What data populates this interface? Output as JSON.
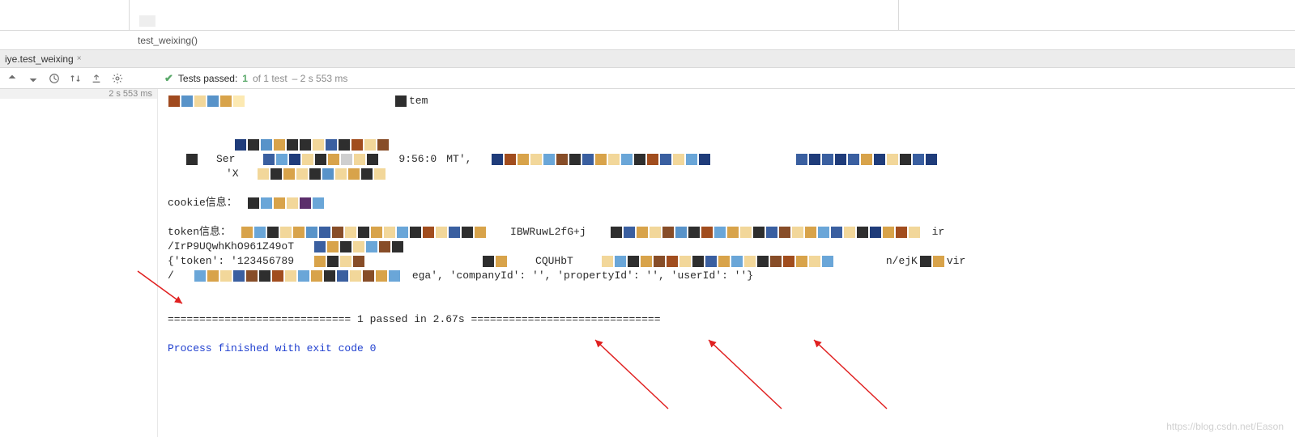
{
  "breadcrumb": "test_weixing()",
  "tab": {
    "label": "iye.test_weixing"
  },
  "toolbar": {
    "tests_label": "Tests passed:",
    "tests_count": "1",
    "tests_rest": "of 1 test",
    "duration": "– 2 s 553 ms"
  },
  "sidebar": {
    "timing": "2 s 553 ms"
  },
  "console": {
    "line_top_partial": "tem",
    "cookie_label": "cookie信息：",
    "token_label": "token信息：",
    "token_mid1": "IBWRuwL2fG+j",
    "token_mid2": "ir",
    "irp_line": "/IrP9UQwhKhO961Z49oT",
    "dict_prefix": "{'token': '123456789",
    "dict_mid1": "CQUHbT",
    "dict_mid2": "n/ejK",
    "dict_mid3": "vir",
    "dict_tail": "ega', 'companyId': '', 'propertyId': '', 'userId': ''}",
    "passed_line": "============================= 1 passed in 2.67s ==============================",
    "exit_line": "Process finished with exit code 0",
    "server_fragment": "Ser",
    "time_fragment": "9:56:0",
    "mt_fragment": "MT',",
    "x_fragment": "'X"
  },
  "cells": {
    "row1": [
      "#a04a1f",
      "#5893c9",
      "#f2d79a",
      "#5893c9",
      "#d8a34a",
      "#fce9b2"
    ],
    "row2": [
      "#1f3c7a",
      "#2e2e2e",
      "#5893c9",
      "#d8a34a",
      "#2e2e2e",
      "#2e2e2e",
      "#f2d79a",
      "#3a5fa0",
      "#2e2e2e",
      "#a14d1e",
      "#f2d79a",
      "#874d28"
    ],
    "row_se1_a": [
      "#2e2e2e"
    ],
    "row_se1_b": [
      "#3a5fa0",
      "#6aa6d8",
      "#1f3c7a",
      "#f2d79a",
      "#2e2e2e",
      "#d8a34a",
      "#cfcfcf",
      "#f2d79a",
      "#2e2e2e"
    ],
    "row_se1_c": [
      "#1f3c7a",
      "#a14d1e",
      "#d8a34a",
      "#f2d79a",
      "#6aa6d8",
      "#874d28",
      "#2e2e2e",
      "#3a5fa0",
      "#d8a34a",
      "#f2d79a",
      "#6aa6d8",
      "#2e2e2e",
      "#a14d1e",
      "#3a5fa0",
      "#f2d79a",
      "#6aa6d8",
      "#1f3c7a"
    ],
    "row_se1_d": [
      "#3a5fa0",
      "#1f3c7a",
      "#3a5fa0",
      "#1f3c7a",
      "#3a5fa0",
      "#d8a34a",
      "#1f3c7a",
      "#f2d79a",
      "#2e2e2e",
      "#3a5fa0",
      "#1f3c7a"
    ],
    "row_x": [
      "#f2d79a",
      "#2e2e2e",
      "#d8a34a",
      "#f2d79a",
      "#2e2e2e",
      "#5893c9",
      "#f2d79a",
      "#d8a34a",
      "#2e2e2e",
      "#f2d79a"
    ],
    "cookie_cells": [
      "#2e2e2e",
      "#6aa6d8",
      "#d8a34a",
      "#f2d79a",
      "#5b2e6b",
      "#6aa6d8"
    ],
    "token_a": [
      "#d8a34a",
      "#6aa6d8",
      "#2e2e2e",
      "#f2d79a",
      "#d8a34a",
      "#5893c9",
      "#3a5fa0",
      "#874d28",
      "#f2d79a",
      "#2e2e2e",
      "#d8a34a",
      "#f2d79a",
      "#6aa6d8",
      "#2e2e2e",
      "#a14d1e",
      "#f2d79a",
      "#3a5fa0",
      "#2e2e2e",
      "#d8a34a"
    ],
    "token_b": [
      "#2e2e2e",
      "#3a5fa0",
      "#d8a34a",
      "#f2d79a",
      "#874d28",
      "#5893c9",
      "#2e2e2e",
      "#a14d1e",
      "#6aa6d8",
      "#d8a34a",
      "#f2d79a",
      "#2e2e2e",
      "#3a5fa0",
      "#874d28",
      "#f2d79a",
      "#d8a34a",
      "#6aa6d8",
      "#3a5fa0",
      "#f2d79a",
      "#2e2e2e",
      "#1f3c7a",
      "#d8a34a",
      "#a14d1e",
      "#f2d79a"
    ],
    "irp_cells": [
      "#3a5fa0",
      "#d8a34a",
      "#2e2e2e",
      "#f2d79a",
      "#6aa6d8",
      "#874d28",
      "#2e2e2e"
    ],
    "dict_a": [
      "#d8a34a",
      "#2e2e2e",
      "#f2d79a",
      "#874d28"
    ],
    "dict_b": [
      "#2e2e2e",
      "#d8a34a"
    ],
    "dict_c": [
      "#f2d79a",
      "#6aa6d8",
      "#2e2e2e",
      "#d8a34a",
      "#874d28",
      "#a14d1e",
      "#f2d79a",
      "#2e2e2e",
      "#3a5fa0",
      "#d8a34a",
      "#6aa6d8",
      "#f2d79a",
      "#2e2e2e",
      "#874d28",
      "#a14d1e",
      "#d8a34a",
      "#f2d79a",
      "#6aa6d8"
    ],
    "dict_d": [
      "#2e2e2e",
      "#d8a34a"
    ],
    "slash_cells": [
      "#6aa6d8",
      "#d8a34a",
      "#f2d79a",
      "#3a5fa0",
      "#874d28",
      "#2e2e2e",
      "#a14d1e",
      "#f2d79a",
      "#6aa6d8",
      "#d8a34a",
      "#2e2e2e",
      "#3a5fa0",
      "#f2d79a",
      "#874d28",
      "#d8a34a",
      "#6aa6d8"
    ]
  },
  "watermark": "https://blog.csdn.net/Eason"
}
